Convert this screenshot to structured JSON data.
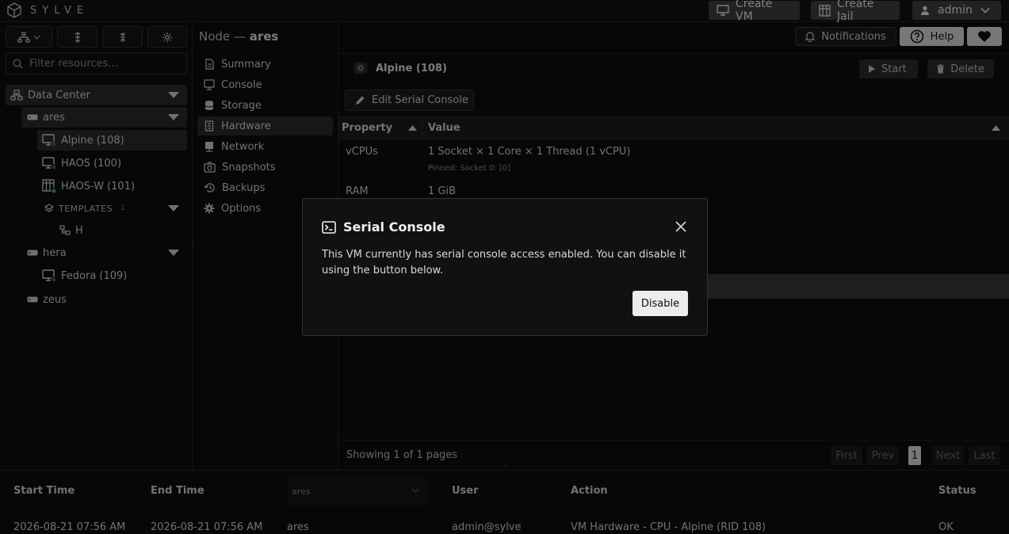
{
  "app": {
    "name": "SYLVE"
  },
  "topbar": {
    "create_vm": "Create VM",
    "create_jail": "Create Jail",
    "user": "admin"
  },
  "sidebar": {
    "filter_placeholder": "Filter resources...",
    "tree": {
      "datacenter": "Data Center",
      "ares": "ares",
      "alpine": "Alpine (108)",
      "haos": "HAOS (100)",
      "haosw": "HAOS-W (101)",
      "templates": "TEMPLATES",
      "templates_count": "1",
      "template_h": "H",
      "hera": "hera",
      "fedora": "Fedora (109)",
      "zeus": "zeus"
    }
  },
  "node": {
    "prefix": "Node —",
    "name": "ares"
  },
  "nav": {
    "items": [
      "Summary",
      "Console",
      "Storage",
      "Hardware",
      "Network",
      "Snapshots",
      "Backups",
      "Options"
    ],
    "active": "Hardware"
  },
  "header_buttons": {
    "notifications": "Notifications",
    "help": "Help"
  },
  "vm": {
    "title": "Alpine (108)",
    "start": "Start",
    "delete": "Delete",
    "edit_serial": "Edit Serial Console"
  },
  "table": {
    "col_property": "Property",
    "col_value": "Value",
    "rows": [
      {
        "property": "vCPUs",
        "value": "1 Socket × 1 Core × 1 Thread (1 vCPU)",
        "sub": "Pinned: Socket 0: [0]"
      },
      {
        "property": "RAM",
        "value": "1 GiB"
      }
    ]
  },
  "pager": {
    "showing": "Showing 1 of 1 pages",
    "first": "First",
    "prev": "Prev",
    "current": "1",
    "next": "Next",
    "last": "Last"
  },
  "log": {
    "headers": {
      "start": "Start Time",
      "end": "End Time",
      "user": "User",
      "action": "Action",
      "status": "Status"
    },
    "node_filter": "ares",
    "row": {
      "start": "2026-08-21 07:56 AM",
      "end": "2026-08-21 07:56 AM",
      "node": "ares",
      "user": "admin@sylve",
      "action": "VM Hardware - CPU - Alpine (RID 108)",
      "status": "OK"
    }
  },
  "dialog": {
    "title": "Serial Console",
    "text": "This VM currently has serial console access enabled. You can disable it using the button below.",
    "button": "Disable"
  },
  "colors": {
    "status_green": "#22c55e",
    "status_red": "#ef4444"
  }
}
